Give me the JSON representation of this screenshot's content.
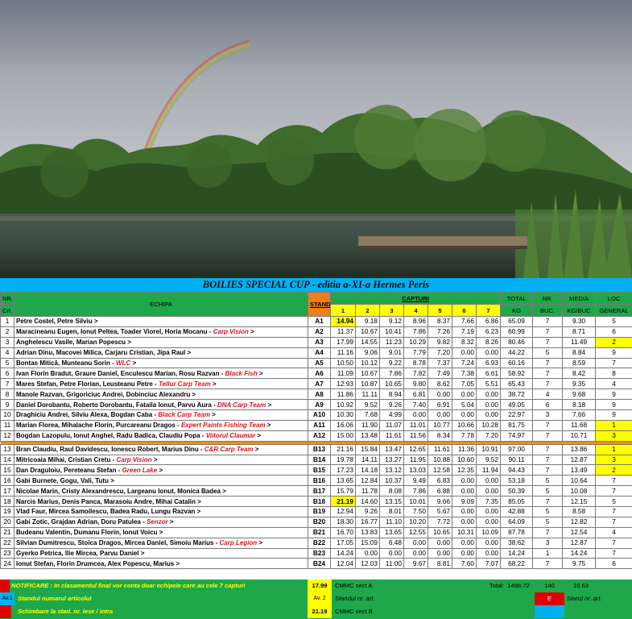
{
  "title": "BOILIES SPECIAL CUP - editia a-XI-a Hermes Peris",
  "header": {
    "nr_top": "NR.",
    "nr_bottom": "Crt.",
    "echipa": "ECHIPA",
    "stand": "STAND",
    "capturi": "CAPTURI",
    "capture_cols": [
      "1",
      "2",
      "3",
      "4",
      "5",
      "6",
      "7"
    ],
    "total_top": "TOTAL",
    "total_bottom": "KG",
    "buc_top": "NR.",
    "buc_bottom": "BUC.",
    "media_top": "MEDIA",
    "media_bottom": "KG/BUC",
    "loc_top": "LOC",
    "loc_bottom": "GENERAL"
  },
  "colors": {
    "title_bg": "#00b0f0",
    "header_bg": "#1fa84a",
    "stand_bg": "#f07d1c",
    "highlight": "#ffff00",
    "team_text": "#e0101c",
    "separator": "#ff8c00"
  },
  "rows": [
    {
      "nr": "1",
      "names": "Petre Costel, Petre Silviu  >",
      "team": "",
      "stand": "A1",
      "caps": [
        "14.94",
        "9.18",
        "9.12",
        "8.96",
        "8.37",
        "7.66",
        "6.86"
      ],
      "hl": [
        0
      ],
      "total": "65.09",
      "buc": "7",
      "media": "9.30",
      "loc": "5",
      "loc_hl": false
    },
    {
      "nr": "2",
      "names": "Maracineanu Eugen, Ionut Peltea, Toader Viorel, Horia Mocanu - ",
      "team": "Carp Vision",
      "stand": "A2",
      "caps": [
        "11.37",
        "10.67",
        "10.41",
        "7.86",
        "7.26",
        "7.19",
        "6.23"
      ],
      "hl": [],
      "total": "60.99",
      "buc": "7",
      "media": "8.71",
      "loc": "6",
      "loc_hl": false
    },
    {
      "nr": "3",
      "names": "Anghelescu Vasile, Marian Popescu  >",
      "team": "",
      "stand": "A3",
      "caps": [
        "17.99",
        "14.55",
        "11.23",
        "10.29",
        "9.82",
        "8.32",
        "8.26"
      ],
      "hl": [],
      "total": "80.46",
      "buc": "7",
      "media": "11.49",
      "loc": "2",
      "loc_hl": true
    },
    {
      "nr": "4",
      "names": "Adrian Dinu, Macovei Milica, Carjaru Cristian, Jipa Raul  >",
      "team": "",
      "stand": "A4",
      "caps": [
        "11.16",
        "9.06",
        "9.01",
        "7.79",
        "7.20",
        "0.00",
        "0.00"
      ],
      "hl": [],
      "total": "44.22",
      "buc": "5",
      "media": "8.84",
      "loc": "9",
      "loc_hl": false
    },
    {
      "nr": "5",
      "names": "Bontas Mitică, Munteanu Sorin - ",
      "team": "WLC",
      "stand": "A5",
      "caps": [
        "10.50",
        "10.12",
        "9.22",
        "8.78",
        "7.37",
        "7.24",
        "6.93"
      ],
      "hl": [],
      "total": "60.16",
      "buc": "7",
      "media": "8.59",
      "loc": "7",
      "loc_hl": false
    },
    {
      "nr": "6",
      "names": "Ivan Florin Bradut, Graure Daniel, Enculescu Marian, Rosu Razvan - ",
      "team": "Black Fish",
      "stand": "A6",
      "caps": [
        "11.09",
        "10.67",
        "7.86",
        "7.82",
        "7.49",
        "7.38",
        "6.61"
      ],
      "hl": [],
      "total": "58.92",
      "buc": "7",
      "media": "8.42",
      "loc": "8",
      "loc_hl": false
    },
    {
      "nr": "7",
      "names": "Mares Stefan, Petre Florian, Leusteanu Petre - ",
      "team": "Tellur Carp Team",
      "stand": "A7",
      "caps": [
        "12.93",
        "10.87",
        "10.65",
        "9.80",
        "8.62",
        "7.05",
        "5.51"
      ],
      "hl": [],
      "total": "65.43",
      "buc": "7",
      "media": "9.35",
      "loc": "4",
      "loc_hl": false
    },
    {
      "nr": "8",
      "names": "Manole Razvan, Grigoriciuc Andrei, Dobinciuc Alexandru  >",
      "team": "",
      "stand": "A8",
      "caps": [
        "11.86",
        "11.11",
        "8.94",
        "6.81",
        "0.00",
        "0.00",
        "0.00"
      ],
      "hl": [],
      "total": "38.72",
      "buc": "4",
      "media": "9.68",
      "loc": "9",
      "loc_hl": false
    },
    {
      "nr": "9",
      "names": "Daniel Dorobantu, Roberto Dorobantu, Fataila Ionut, Parvu Aura - ",
      "team": "DNA Carp Team",
      "stand": "A9",
      "caps": [
        "10.92",
        "9.52",
        "9.26",
        "7.40",
        "6.91",
        "5.04",
        "0.00"
      ],
      "hl": [],
      "total": "49.05",
      "buc": "6",
      "media": "8.18",
      "loc": "9",
      "loc_hl": false
    },
    {
      "nr": "10",
      "names": "Draghiciu Andrei, Silviu Alexa, Bogdan Caba - ",
      "team": "Black Carp Team",
      "stand": "A10",
      "caps": [
        "10.30",
        "7.68",
        "4.99",
        "0.00",
        "0.00",
        "0.00",
        "0.00"
      ],
      "hl": [],
      "total": "22.97",
      "buc": "3",
      "media": "7.66",
      "loc": "9",
      "loc_hl": false
    },
    {
      "nr": "11",
      "names": "Marian Florea, Mihalache Florin, Purcareanu Dragos - ",
      "team": "Expert Paints Fishing Team",
      "stand": "A11",
      "caps": [
        "16.06",
        "11.90",
        "11.07",
        "11.01",
        "10.77",
        "10.66",
        "10.28"
      ],
      "hl": [],
      "total": "81.75",
      "buc": "7",
      "media": "11.68",
      "loc": "1",
      "loc_hl": true
    },
    {
      "nr": "12",
      "names": "Bogdan Lazopulu, Ionut Anghel, Radu Badica, Claudiu Popa - ",
      "team": "Viitorul Claumar",
      "stand": "A12",
      "caps": [
        "15.00",
        "13.48",
        "11.61",
        "11.56",
        "8.34",
        "7.78",
        "7.20"
      ],
      "hl": [],
      "total": "74.97",
      "buc": "7",
      "media": "10.71",
      "loc": "3",
      "loc_hl": true
    },
    {
      "nr": "13",
      "names": "Bran Claudiu, Raul Davidescu, Ionescu Robert, Marius Dinu - ",
      "team": "C&R Carp Team",
      "stand": "B13",
      "caps": [
        "21.16",
        "15.84",
        "13.47",
        "12.65",
        "11.61",
        "11.36",
        "10.91"
      ],
      "hl": [],
      "total": "97.00",
      "buc": "7",
      "media": "13.86",
      "loc": "1",
      "loc_hl": true
    },
    {
      "nr": "14",
      "names": "Mitricoaia Mihai, Cristian Cretu - ",
      "team": "Carp Vision",
      "stand": "B14",
      "caps": [
        "19.78",
        "14.11",
        "13.27",
        "11.95",
        "10.88",
        "10.60",
        "9.52"
      ],
      "hl": [],
      "total": "90.11",
      "buc": "7",
      "media": "12.87",
      "loc": "3",
      "loc_hl": true
    },
    {
      "nr": "15",
      "names": "Dan Draguloiu, Pereteanu Stefan - ",
      "team": "Green Lake",
      "stand": "B15",
      "caps": [
        "17.23",
        "14.18",
        "13.12",
        "13.03",
        "12.58",
        "12.35",
        "11.94"
      ],
      "hl": [],
      "total": "94.43",
      "buc": "7",
      "media": "13.49",
      "loc": "2",
      "loc_hl": true
    },
    {
      "nr": "16",
      "names": "Gabi Burnete, Gogu, Vali, Tutu  >",
      "team": "",
      "stand": "B16",
      "caps": [
        "13.65",
        "12.84",
        "10.37",
        "9.49",
        "6.83",
        "0.00",
        "0.00"
      ],
      "hl": [],
      "total": "53.18",
      "buc": "5",
      "media": "10.64",
      "loc": "7",
      "loc_hl": false
    },
    {
      "nr": "17",
      "names": "Nicolae Marin, Cristy Alexandrescu, Largeanu Ionut, Monica Badea  >",
      "team": "",
      "stand": "B17",
      "caps": [
        "15.79",
        "11.78",
        "8.08",
        "7.86",
        "6.88",
        "0.00",
        "0.00"
      ],
      "hl": [],
      "total": "50.39",
      "buc": "5",
      "media": "10.08",
      "loc": "7",
      "loc_hl": false
    },
    {
      "nr": "18",
      "names": "Narcis Marius, Denis Panca, Marasoiu Andre, Mihai Catalin  >",
      "team": "",
      "stand": "B18",
      "caps": [
        "21.19",
        "14.60",
        "13.15",
        "10.01",
        "9.66",
        "9.09",
        "7.35"
      ],
      "hl": [
        0
      ],
      "total": "85.05",
      "buc": "7",
      "media": "12.15",
      "loc": "5",
      "loc_hl": false
    },
    {
      "nr": "19",
      "names": "Vlad Faur, Mircea Samoilescu, Badea Radu, Lungu Razvan  >",
      "team": "",
      "stand": "B19",
      "caps": [
        "12.94",
        "9.26",
        "8.01",
        "7.50",
        "5.67",
        "0.00",
        "0.00"
      ],
      "hl": [],
      "total": "42.88",
      "buc": "5",
      "media": "8.58",
      "loc": "7",
      "loc_hl": false
    },
    {
      "nr": "20",
      "names": "Gabi Zotic, Grajdan Adrian, Doru Patulea - ",
      "team": "Senzor",
      "stand": "B20",
      "caps": [
        "18.30",
        "16.77",
        "11.10",
        "10.20",
        "7.72",
        "0.00",
        "0.00"
      ],
      "hl": [],
      "total": "64.09",
      "buc": "5",
      "media": "12.82",
      "loc": "7",
      "loc_hl": false
    },
    {
      "nr": "21",
      "names": "Budeanu Valentin, Dumanu Florin, Ionut Voicu  >",
      "team": "",
      "stand": "B21",
      "caps": [
        "16.70",
        "13.83",
        "13.65",
        "12.55",
        "10.65",
        "10.31",
        "10.09"
      ],
      "hl": [],
      "total": "87.78",
      "buc": "7",
      "media": "12.54",
      "loc": "4",
      "loc_hl": false
    },
    {
      "nr": "22",
      "names": "Silvian Dumitrescu, Stoica Dragos, Mircea Daniel, Simoiu Marius - ",
      "team": "Carp Legion",
      "stand": "B22",
      "caps": [
        "17.05",
        "15.09",
        "6.48",
        "0.00",
        "0.00",
        "0.00",
        "0.00"
      ],
      "hl": [],
      "total": "38.62",
      "buc": "3",
      "media": "12.87",
      "loc": "7",
      "loc_hl": false
    },
    {
      "nr": "23",
      "names": "Gyerko Petrica, Ilie Mircea, Parvu Daniel  >",
      "team": "",
      "stand": "B23",
      "caps": [
        "14.24",
        "0.00",
        "0.00",
        "0.00",
        "0.00",
        "0.00",
        "0.00"
      ],
      "hl": [],
      "total": "14.24",
      "buc": "1",
      "media": "14.24",
      "loc": "7",
      "loc_hl": false
    },
    {
      "nr": "24",
      "names": "Ionut Stefan, Florin Drumcea, Alex Popescu, Marius  >",
      "team": "",
      "stand": "B24",
      "caps": [
        "12.04",
        "12.03",
        "11.00",
        "9.67",
        "8.81",
        "7.60",
        "7.07"
      ],
      "hl": [],
      "total": "68.22",
      "buc": "7",
      "media": "9.75",
      "loc": "6",
      "loc_hl": false
    }
  ],
  "footer": {
    "notice": "NOTIFICARE :  In clasamentul final vor conta doar echipele care au cele 7 capturi",
    "notice_val": "17.99",
    "notice_label": "CMMC sect  A",
    "total_label": "Total:",
    "total_kg": "1488.72",
    "total_buc": "140",
    "total_media": "10.63",
    "av_tag": "Av.1",
    "av_text": "Standul numarul          articolul",
    "av2_tag": "Av. 2",
    "stand_nr_art": "Standul  nr.     art.",
    "e_tag": "E",
    "stand_nr_art2": "Stand nr.        art.",
    "change_text": "Schimbare la stad.  nr.    iese / intra",
    "change_val": "21.19",
    "change_label": "CMMC sect  B"
  }
}
